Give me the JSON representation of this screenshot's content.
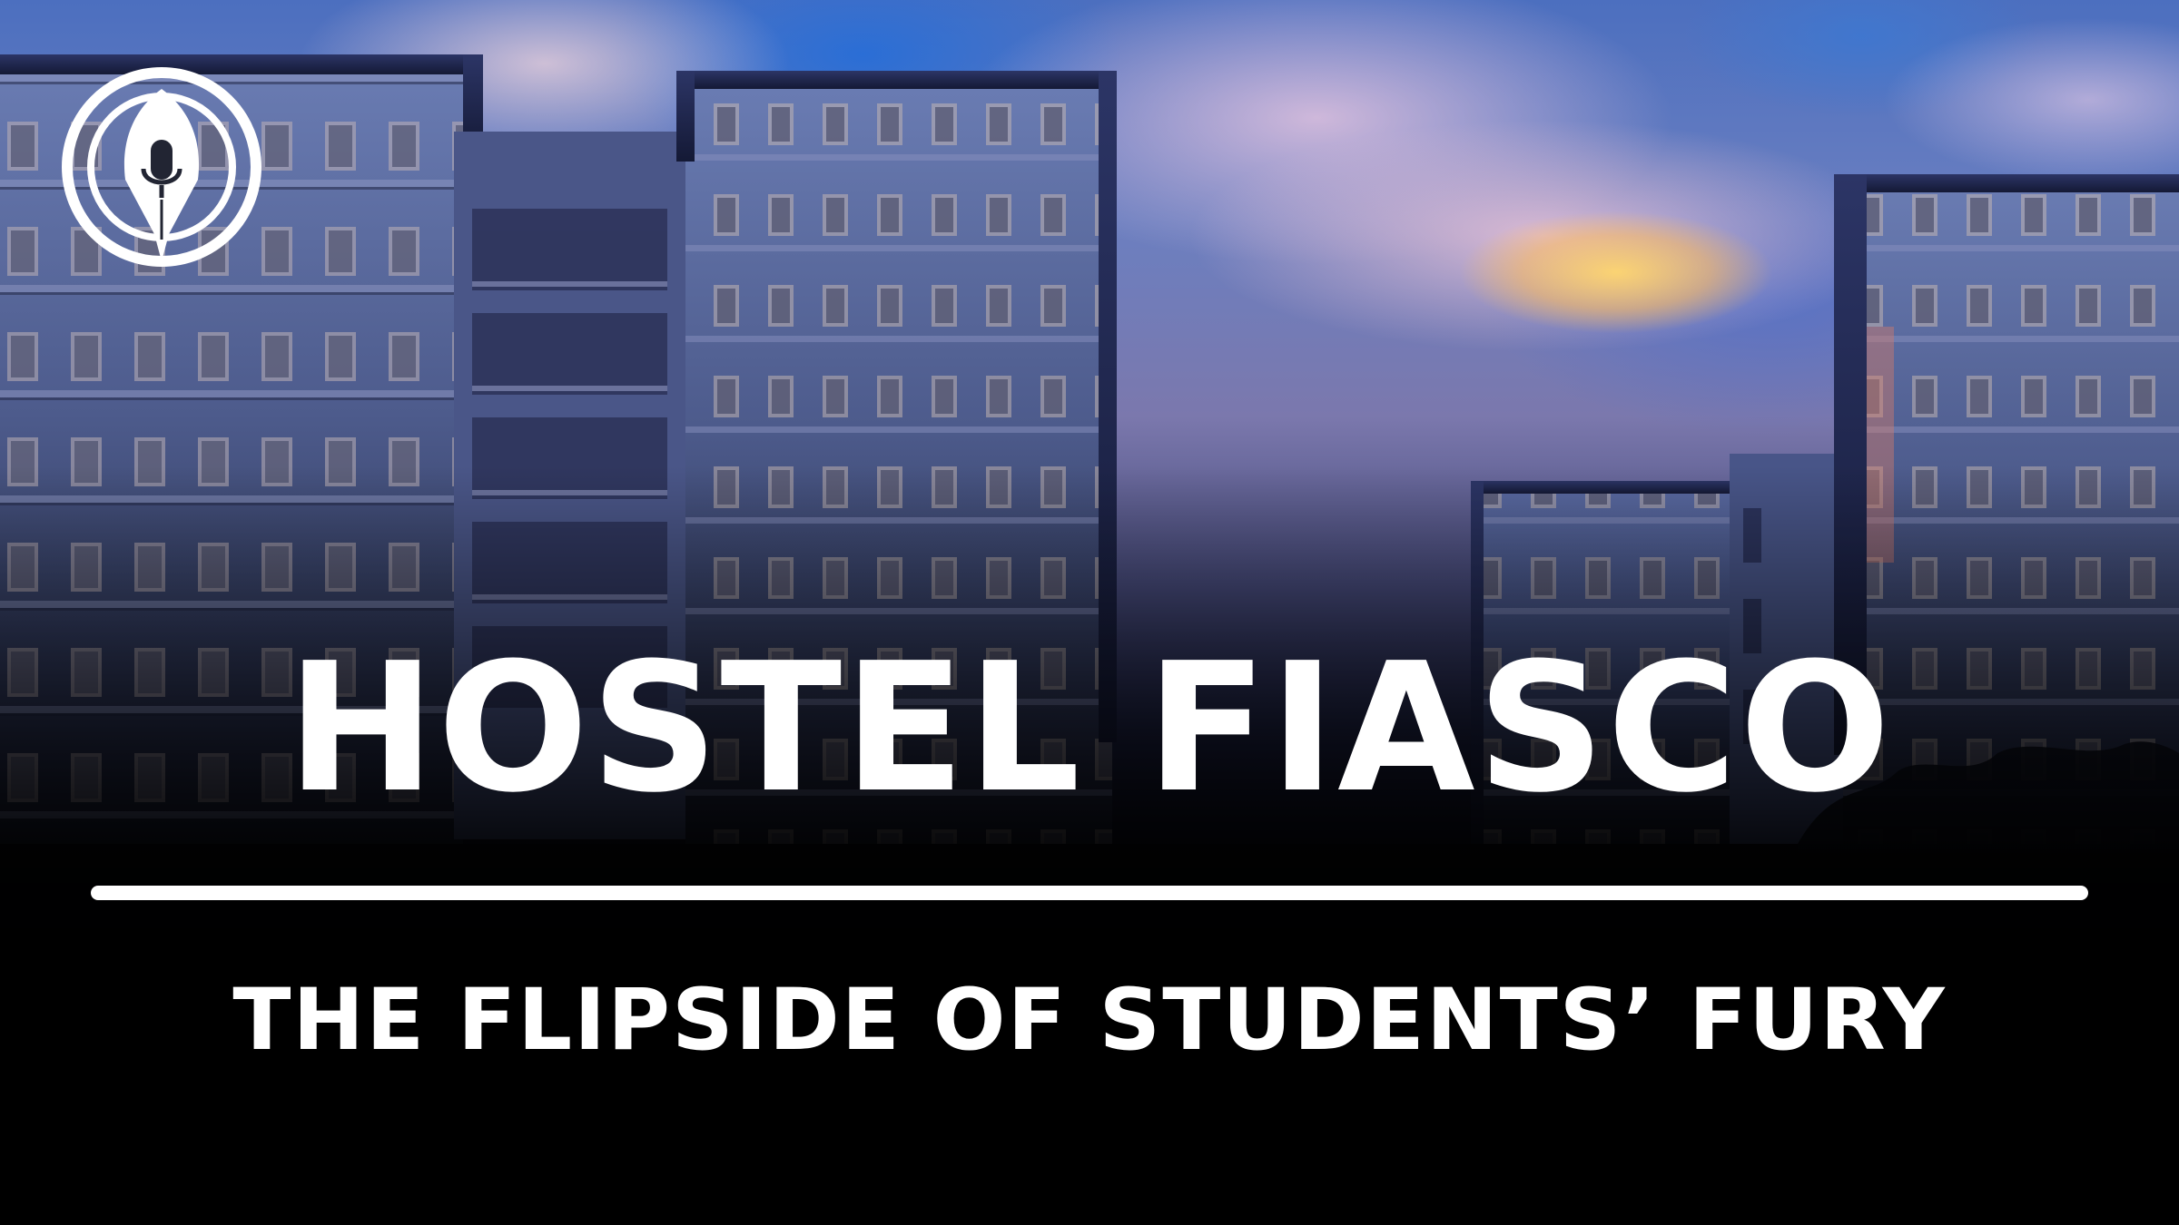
{
  "thumbnail": {
    "title": "HOSTEL FIASCO",
    "subtitle": "THE FLIPSIDE OF STUDENTS’ FURY"
  },
  "logo": {
    "icon": "pen-nib-microphone-icon",
    "color": "#ffffff"
  },
  "background": {
    "scene": "hostel-buildings-at-dusk",
    "accent_colors": [
      "#3a6fd8",
      "#f4c86a",
      "#2a2f56"
    ]
  }
}
